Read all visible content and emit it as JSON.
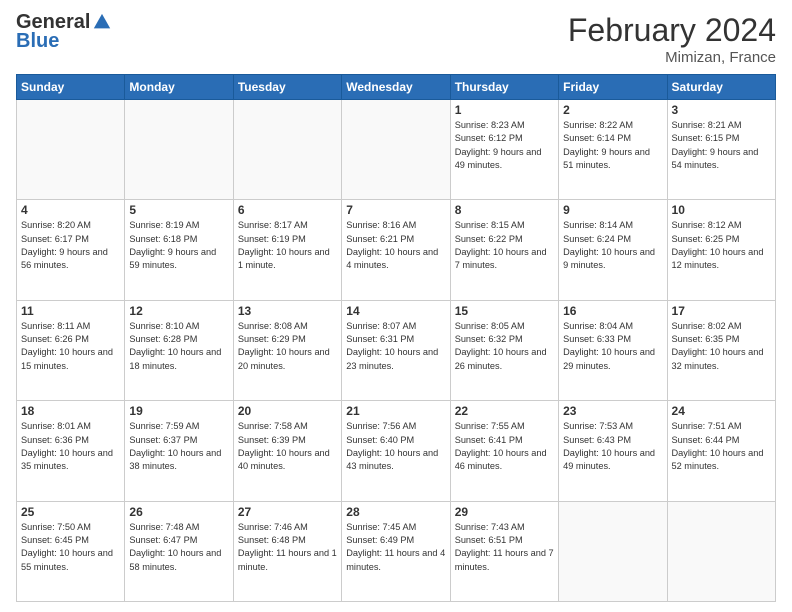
{
  "header": {
    "logo_general": "General",
    "logo_blue": "Blue",
    "month_title": "February 2024",
    "location": "Mimizan, France"
  },
  "days_of_week": [
    "Sunday",
    "Monday",
    "Tuesday",
    "Wednesday",
    "Thursday",
    "Friday",
    "Saturday"
  ],
  "weeks": [
    [
      {
        "num": "",
        "info": ""
      },
      {
        "num": "",
        "info": ""
      },
      {
        "num": "",
        "info": ""
      },
      {
        "num": "",
        "info": ""
      },
      {
        "num": "1",
        "info": "Sunrise: 8:23 AM\nSunset: 6:12 PM\nDaylight: 9 hours\nand 49 minutes."
      },
      {
        "num": "2",
        "info": "Sunrise: 8:22 AM\nSunset: 6:14 PM\nDaylight: 9 hours\nand 51 minutes."
      },
      {
        "num": "3",
        "info": "Sunrise: 8:21 AM\nSunset: 6:15 PM\nDaylight: 9 hours\nand 54 minutes."
      }
    ],
    [
      {
        "num": "4",
        "info": "Sunrise: 8:20 AM\nSunset: 6:17 PM\nDaylight: 9 hours\nand 56 minutes."
      },
      {
        "num": "5",
        "info": "Sunrise: 8:19 AM\nSunset: 6:18 PM\nDaylight: 9 hours\nand 59 minutes."
      },
      {
        "num": "6",
        "info": "Sunrise: 8:17 AM\nSunset: 6:19 PM\nDaylight: 10 hours\nand 1 minute."
      },
      {
        "num": "7",
        "info": "Sunrise: 8:16 AM\nSunset: 6:21 PM\nDaylight: 10 hours\nand 4 minutes."
      },
      {
        "num": "8",
        "info": "Sunrise: 8:15 AM\nSunset: 6:22 PM\nDaylight: 10 hours\nand 7 minutes."
      },
      {
        "num": "9",
        "info": "Sunrise: 8:14 AM\nSunset: 6:24 PM\nDaylight: 10 hours\nand 9 minutes."
      },
      {
        "num": "10",
        "info": "Sunrise: 8:12 AM\nSunset: 6:25 PM\nDaylight: 10 hours\nand 12 minutes."
      }
    ],
    [
      {
        "num": "11",
        "info": "Sunrise: 8:11 AM\nSunset: 6:26 PM\nDaylight: 10 hours\nand 15 minutes."
      },
      {
        "num": "12",
        "info": "Sunrise: 8:10 AM\nSunset: 6:28 PM\nDaylight: 10 hours\nand 18 minutes."
      },
      {
        "num": "13",
        "info": "Sunrise: 8:08 AM\nSunset: 6:29 PM\nDaylight: 10 hours\nand 20 minutes."
      },
      {
        "num": "14",
        "info": "Sunrise: 8:07 AM\nSunset: 6:31 PM\nDaylight: 10 hours\nand 23 minutes."
      },
      {
        "num": "15",
        "info": "Sunrise: 8:05 AM\nSunset: 6:32 PM\nDaylight: 10 hours\nand 26 minutes."
      },
      {
        "num": "16",
        "info": "Sunrise: 8:04 AM\nSunset: 6:33 PM\nDaylight: 10 hours\nand 29 minutes."
      },
      {
        "num": "17",
        "info": "Sunrise: 8:02 AM\nSunset: 6:35 PM\nDaylight: 10 hours\nand 32 minutes."
      }
    ],
    [
      {
        "num": "18",
        "info": "Sunrise: 8:01 AM\nSunset: 6:36 PM\nDaylight: 10 hours\nand 35 minutes."
      },
      {
        "num": "19",
        "info": "Sunrise: 7:59 AM\nSunset: 6:37 PM\nDaylight: 10 hours\nand 38 minutes."
      },
      {
        "num": "20",
        "info": "Sunrise: 7:58 AM\nSunset: 6:39 PM\nDaylight: 10 hours\nand 40 minutes."
      },
      {
        "num": "21",
        "info": "Sunrise: 7:56 AM\nSunset: 6:40 PM\nDaylight: 10 hours\nand 43 minutes."
      },
      {
        "num": "22",
        "info": "Sunrise: 7:55 AM\nSunset: 6:41 PM\nDaylight: 10 hours\nand 46 minutes."
      },
      {
        "num": "23",
        "info": "Sunrise: 7:53 AM\nSunset: 6:43 PM\nDaylight: 10 hours\nand 49 minutes."
      },
      {
        "num": "24",
        "info": "Sunrise: 7:51 AM\nSunset: 6:44 PM\nDaylight: 10 hours\nand 52 minutes."
      }
    ],
    [
      {
        "num": "25",
        "info": "Sunrise: 7:50 AM\nSunset: 6:45 PM\nDaylight: 10 hours\nand 55 minutes."
      },
      {
        "num": "26",
        "info": "Sunrise: 7:48 AM\nSunset: 6:47 PM\nDaylight: 10 hours\nand 58 minutes."
      },
      {
        "num": "27",
        "info": "Sunrise: 7:46 AM\nSunset: 6:48 PM\nDaylight: 11 hours\nand 1 minute."
      },
      {
        "num": "28",
        "info": "Sunrise: 7:45 AM\nSunset: 6:49 PM\nDaylight: 11 hours\nand 4 minutes."
      },
      {
        "num": "29",
        "info": "Sunrise: 7:43 AM\nSunset: 6:51 PM\nDaylight: 11 hours\nand 7 minutes."
      },
      {
        "num": "",
        "info": ""
      },
      {
        "num": "",
        "info": ""
      }
    ]
  ]
}
